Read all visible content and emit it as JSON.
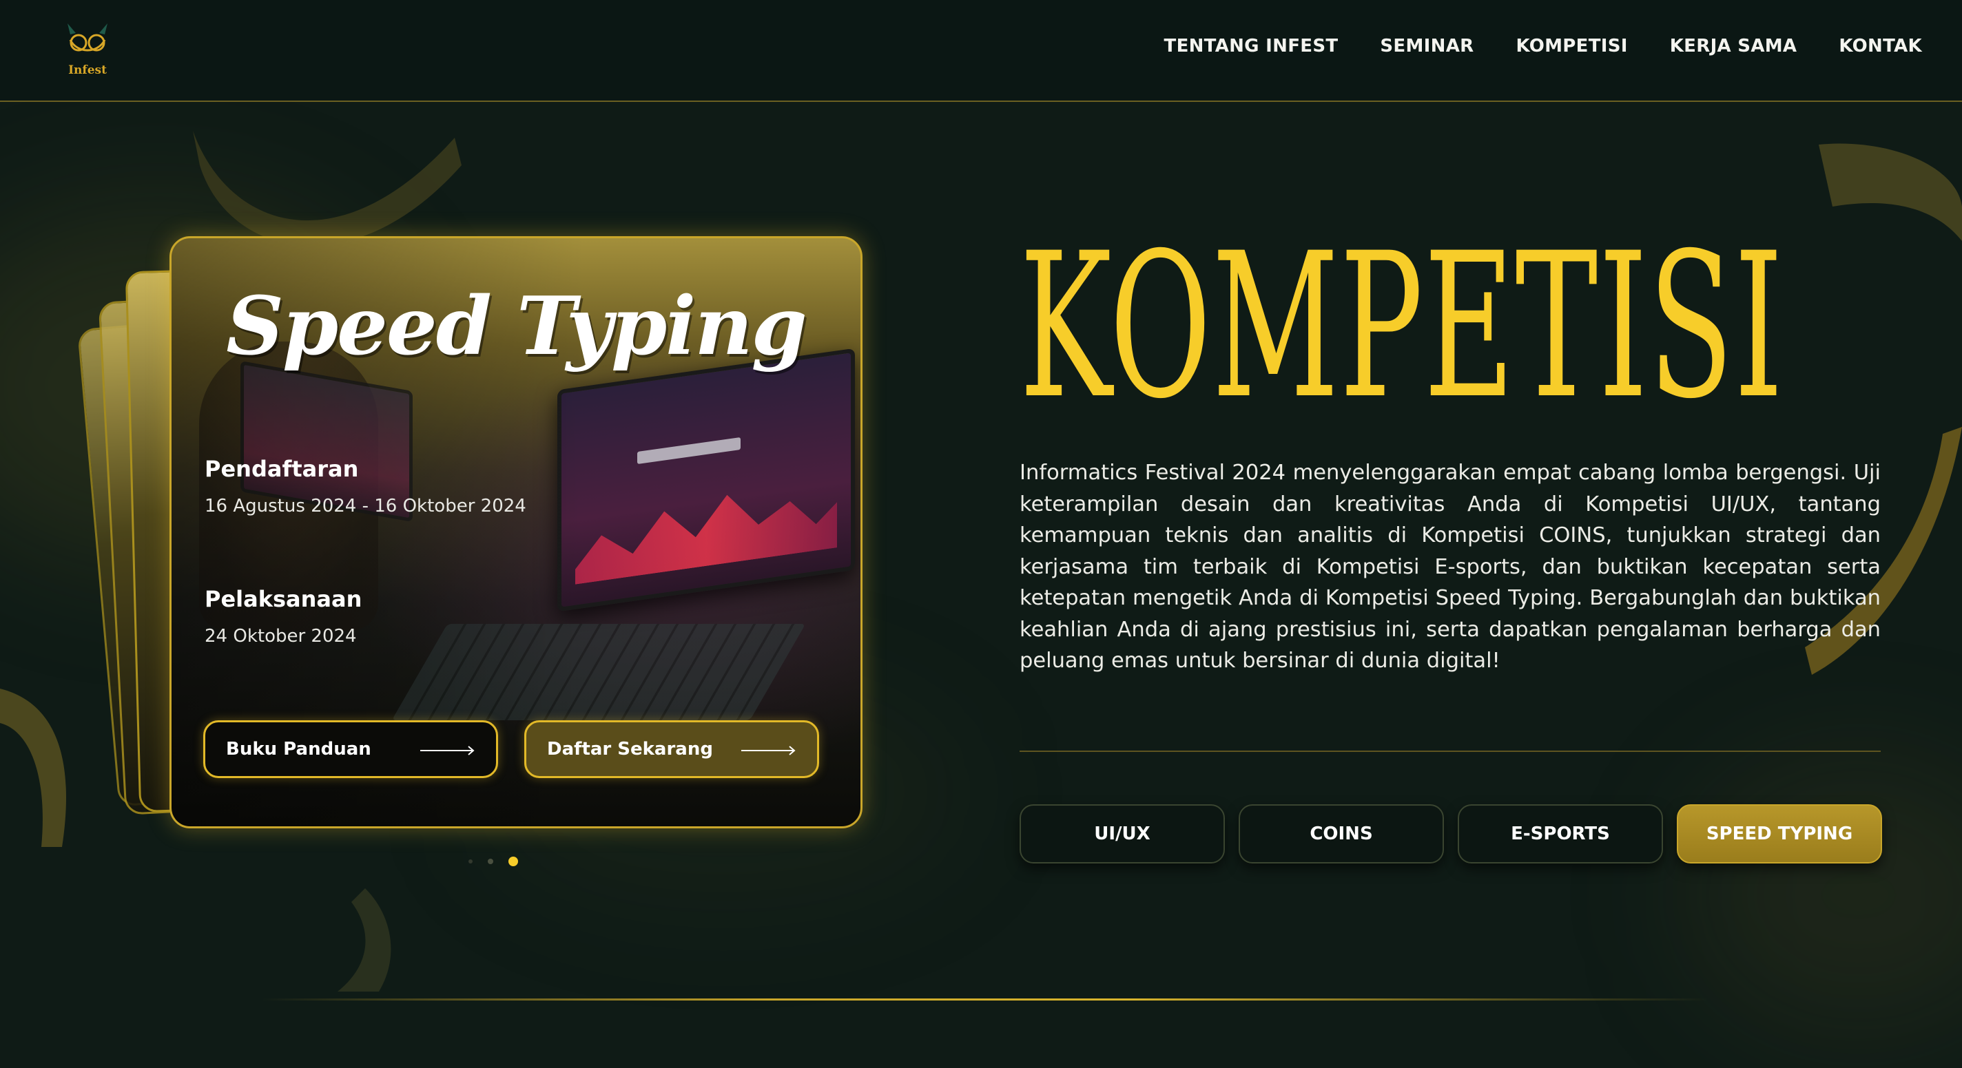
{
  "brand": {
    "logo_text": "Infest"
  },
  "nav": {
    "items": [
      {
        "label": "TENTANG INFEST"
      },
      {
        "label": "SEMINAR"
      },
      {
        "label": "KOMPETISI"
      },
      {
        "label": "KERJA SAMA"
      },
      {
        "label": "KONTAK"
      }
    ]
  },
  "card": {
    "title": "Speed Typing",
    "registration": {
      "label": "Pendaftaran",
      "value": "16 Agustus 2024 - 16 Oktober 2024"
    },
    "execution": {
      "label": "Pelaksanaan",
      "value": "24 Oktober 2024"
    },
    "buttons": {
      "guide": "Buku Panduan",
      "register": "Daftar Sekarang"
    },
    "carousel": {
      "total": 3,
      "active_index": 2
    }
  },
  "section": {
    "heading": "KOMPETISI",
    "description": "Informatics Festival 2024 menyelenggarakan empat cabang lomba bergengsi. Uji keterampilan desain dan kreativitas Anda di Kompetisi UI/UX, tantang kemampuan teknis dan analitis di Kompetisi COINS, tunjukkan strategi dan kerjasama tim terbaik di Kompetisi E-sports, dan buktikan kecepatan serta ketepatan mengetik Anda di Kompetisi Speed Typing. Bergabunglah dan buktikan keahlian Anda di ajang prestisius ini, serta dapatkan pengalaman berharga dan peluang emas untuk bersinar di dunia digital!"
  },
  "tabs": [
    {
      "label": "UI/UX",
      "active": false
    },
    {
      "label": "COINS",
      "active": false
    },
    {
      "label": "E-SPORTS",
      "active": false
    },
    {
      "label": "SPEED TYPING",
      "active": true
    }
  ],
  "colors": {
    "accent": "#f7cd2a",
    "active_tab": "#a98a22",
    "background": "#0f1b16"
  }
}
